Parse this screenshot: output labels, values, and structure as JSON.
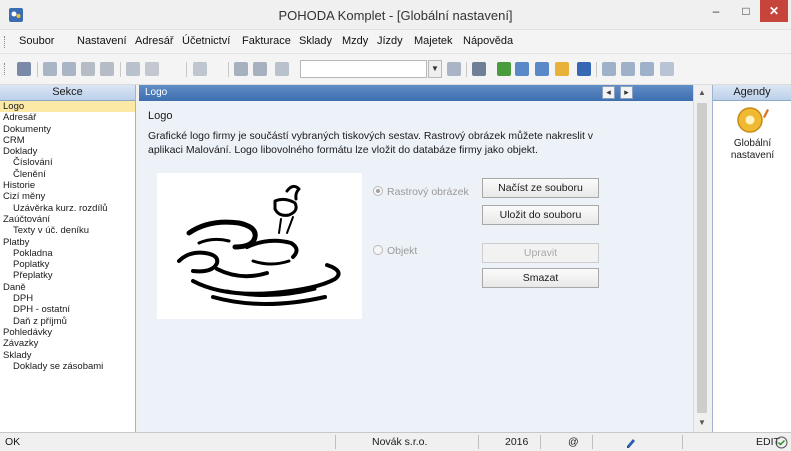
{
  "window": {
    "title": "POHODA Komplet - [Globální nastavení]",
    "minimize": "–",
    "maximize": "□",
    "close": "✕"
  },
  "menu": [
    "Soubor",
    "Nastavení",
    "Adresář",
    "Účetnictví",
    "Fakturace",
    "Sklady",
    "Mzdy",
    "Jízdy",
    "Majetek",
    "Nápověda"
  ],
  "toolbar": {
    "search_value": "",
    "icons": [
      "document-icon",
      "print-icon",
      "print-preview-icon",
      "open-icon",
      "new-record-icon",
      "edit-record-icon",
      "navigate-icon",
      "save-icon",
      "save-all-icon",
      "copy-icon",
      "filter-icon",
      "folder-icon",
      "refresh-icon",
      "table-icon",
      "calculator-icon",
      "user-icon",
      "ban-icon",
      "list-icon",
      "grid-icon",
      "help-icon"
    ]
  },
  "sections": {
    "header": "Sekce",
    "items": [
      {
        "label": "Logo",
        "level": 0,
        "selected": true
      },
      {
        "label": "Adresář",
        "level": 0
      },
      {
        "label": "Dokumenty",
        "level": 0
      },
      {
        "label": "CRM",
        "level": 0
      },
      {
        "label": "Doklady",
        "level": 0
      },
      {
        "label": "Číslování",
        "level": 1
      },
      {
        "label": "Členění",
        "level": 1
      },
      {
        "label": "Historie",
        "level": 0
      },
      {
        "label": "Cizí měny",
        "level": 0
      },
      {
        "label": "Uzávěrka kurz. rozdílů",
        "level": 1
      },
      {
        "label": "Zaúčtování",
        "level": 0
      },
      {
        "label": "Texty v úč. deníku",
        "level": 1
      },
      {
        "label": "Platby",
        "level": 0
      },
      {
        "label": "Pokladna",
        "level": 1
      },
      {
        "label": "Poplatky",
        "level": 1
      },
      {
        "label": "Přeplatky",
        "level": 1
      },
      {
        "label": "Daně",
        "level": 0
      },
      {
        "label": "DPH",
        "level": 1
      },
      {
        "label": "DPH - ostatní",
        "level": 1
      },
      {
        "label": "Daň z příjmů",
        "level": 1
      },
      {
        "label": "Pohledávky",
        "level": 0
      },
      {
        "label": "Závazky",
        "level": 0
      },
      {
        "label": "Sklady",
        "level": 0
      },
      {
        "label": "Doklady se zásobami",
        "level": 1
      }
    ]
  },
  "main": {
    "header": "Logo",
    "title": "Logo",
    "description": "Grafické logo firmy je součástí vybraných tiskových sestav. Rastrový obrázek můžete nakreslit v aplikaci Malování. Logo libovolného formátu lze vložit do databáze firmy jako objekt.",
    "radio_raster": "Rastrový obrázek",
    "radio_object": "Objekt",
    "btn_load": "Načíst ze souboru",
    "btn_save": "Uložit do souboru",
    "btn_edit": "Upravit",
    "btn_delete": "Smazat"
  },
  "agendy": {
    "header": "Agendy",
    "item": "Globální nastavení"
  },
  "status": {
    "state": "OK",
    "company": "Novák s.r.o.",
    "year": "2016",
    "at": "@",
    "mode": "EDIT"
  }
}
